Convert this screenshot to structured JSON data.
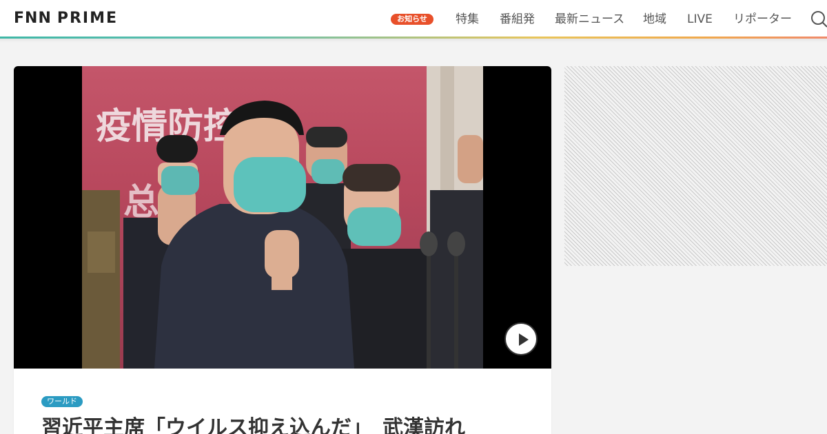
{
  "site": {
    "logo_text_a": "FNN",
    "logo_text_b": "PRIME",
    "colors": {
      "teal": "#3fb7a6",
      "orange": "#e8502a",
      "blue": "#2b9bc2"
    }
  },
  "nav": {
    "notice_badge": "お知らせ",
    "items": [
      "特集",
      "番組発",
      "最新ニュース",
      "地域",
      "LIVE",
      "リポーター"
    ],
    "search_icon": "search-icon"
  },
  "article": {
    "video": {
      "backdrop_text": "疫情防控的",
      "backdrop_text_2": "总体"
    },
    "category": "ワールド",
    "headline": "習近平主席「ウイルス抑え込んだ」　武漢訪れ"
  }
}
